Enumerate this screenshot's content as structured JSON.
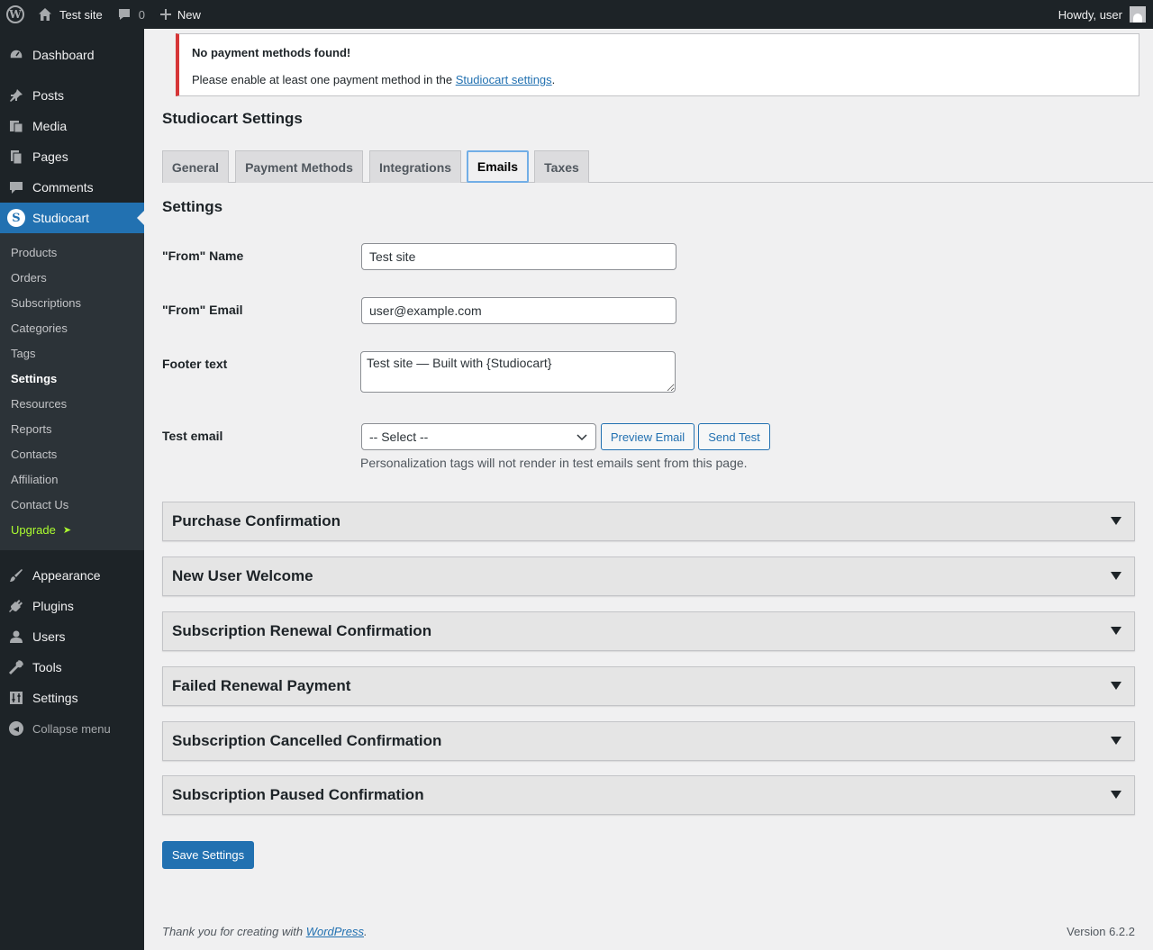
{
  "adminbar": {
    "site_name": "Test site",
    "comments_count": "0",
    "new_label": "New",
    "howdy": "Howdy, user"
  },
  "sidebar": {
    "items_top": [
      {
        "label": "Dashboard",
        "icon": "dashboard-icon"
      },
      {
        "label": "Posts",
        "icon": "pin-icon"
      },
      {
        "label": "Media",
        "icon": "media-icon"
      },
      {
        "label": "Pages",
        "icon": "pages-icon"
      },
      {
        "label": "Comments",
        "icon": "comment-icon"
      },
      {
        "label": "Studiocart",
        "icon": "studiocart-logo-icon"
      }
    ],
    "submenu": [
      "Products",
      "Orders",
      "Subscriptions",
      "Categories",
      "Tags",
      "Settings",
      "Resources",
      "Reports",
      "Contacts",
      "Affiliation",
      "Contact Us",
      "Upgrade"
    ],
    "upgrade_arrow": "➤",
    "items_bottom": [
      {
        "label": "Appearance",
        "icon": "brush-icon"
      },
      {
        "label": "Plugins",
        "icon": "plug-icon"
      },
      {
        "label": "Users",
        "icon": "user-icon"
      },
      {
        "label": "Tools",
        "icon": "wrench-icon"
      },
      {
        "label": "Settings",
        "icon": "settings-icon"
      }
    ],
    "collapse_label": "Collapse menu"
  },
  "notice": {
    "title": "No payment methods found!",
    "text_before": "Please enable at least one payment method in the ",
    "link_text": "Studiocart settings",
    "text_after": "."
  },
  "page_title": "Studiocart Settings",
  "tabs": [
    "General",
    "Payment Methods",
    "Integrations",
    "Emails",
    "Taxes"
  ],
  "active_tab": "Emails",
  "settings": {
    "section_title": "Settings",
    "from_name_label": "\"From\" Name",
    "from_name_value": "Test site",
    "from_email_label": "\"From\" Email",
    "from_email_value": "user@example.com",
    "footer_label": "Footer text",
    "footer_value": "Test site — Built with {Studiocart}",
    "test_email_label": "Test email",
    "select_value": "-- Select --",
    "preview_button": "Preview Email",
    "send_button": "Send Test",
    "hint": "Personalization tags will not render in test emails sent from this page."
  },
  "accordions": [
    "Purchase Confirmation",
    "New User Welcome",
    "Subscription Renewal Confirmation",
    "Failed Renewal Payment",
    "Subscription Cancelled Confirmation",
    "Subscription Paused Confirmation"
  ],
  "save_button": "Save Settings",
  "footer": {
    "thanks_before": "Thank you for creating with ",
    "thanks_link": "WordPress",
    "thanks_after": ".",
    "version": "Version 6.2.2"
  },
  "colors": {
    "accent": "#2271b1",
    "notice_error": "#d63638",
    "upgrade": "#adff2f"
  }
}
